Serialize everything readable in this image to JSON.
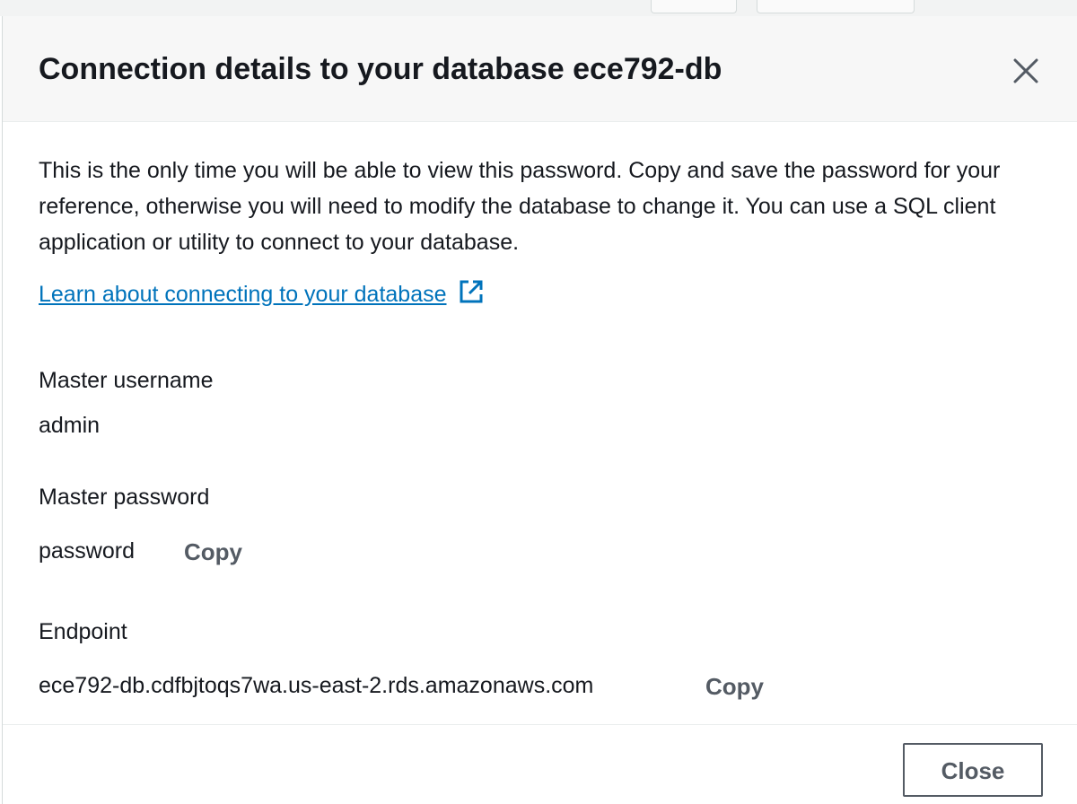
{
  "modal": {
    "title": "Connection details to your database ece792-db",
    "description": "This is the only time you will be able to view this password. Copy and save the password for your reference, otherwise you will need to modify the database to change it. You can use a SQL client application or utility to connect to your database.",
    "learn_link": "Learn about connecting to your database",
    "fields": {
      "username": {
        "label": "Master username",
        "value": "admin"
      },
      "password": {
        "label": "Master password",
        "value": "password",
        "copy_label": "Copy"
      },
      "endpoint": {
        "label": "Endpoint",
        "value": "ece792-db.cdfbjtoqs7wa.us-east-2.rds.amazonaws.com",
        "copy_label": "Copy"
      }
    },
    "footer": {
      "close_label": "Close"
    }
  },
  "colors": {
    "link": "#0073bb",
    "text": "#16191f",
    "secondary_text": "#545b64",
    "header_bg": "#f7f7f7"
  },
  "icons": {
    "close": "close-x-icon",
    "external": "external-link-icon"
  }
}
